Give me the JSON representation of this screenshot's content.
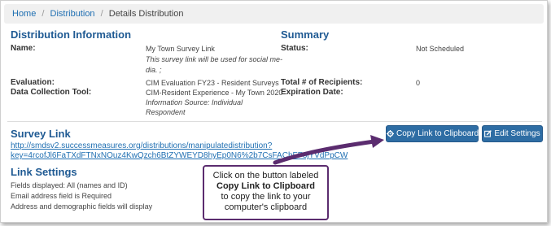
{
  "breadcrumb": {
    "home": "Home",
    "distribution": "Distribution",
    "current": "Details Distribution",
    "separator": "/"
  },
  "distribution_info": {
    "heading": "Distribution Information",
    "name_label": "Name:",
    "name_value": "My Town Survey Link",
    "name_desc_line1": "This survey link will be used for social me-",
    "name_desc_line2": "dia. ;",
    "evaluation_label": "Evaluation:",
    "evaluation_value": "CIM Evaluation FY23 - Resident Surveys",
    "tool_label": "Data Collection Tool:",
    "tool_value": "CIM-Resident Experience - My Town 2020",
    "info_source_line1": "Information Source: Individual",
    "info_source_line2": "Respondent"
  },
  "summary": {
    "heading": "Summary",
    "status_label": "Status:",
    "status_value": "Not Scheduled",
    "recipients_label": "Total # of Recipients:",
    "recipients_value": "0",
    "expiration_label": "Expiration Date:"
  },
  "survey_link": {
    "heading": "Survey Link",
    "url_line1": "http://smdsv2.successmeasures.org/distributions/manipulatedistribution?",
    "url_line2": "key=4rcofJl6FaTXdFTNxNOuz4KwQzch6BtZYWEYD8hyEp0N6%2b7CsFAChFF8jYVdPpCW",
    "copy_button": "Copy Link to Clipboard",
    "edit_button": "Edit Settings"
  },
  "link_settings": {
    "heading": "Link Settings",
    "line1": "Fields displayed: All (names and ID)",
    "line2": "Email address field is Required",
    "line3": "Address and demographic fields will display"
  },
  "callout": {
    "line1": "Click on the button labeled",
    "line2": "Copy Link to Clipboard",
    "line3": "to copy the link to your",
    "line4": "computer's clipboard"
  },
  "colors": {
    "heading": "#1f5a93",
    "link": "#1f6fb2",
    "button": "#2e6da4",
    "callout_border": "#5b2c6f"
  },
  "icons": {
    "copy_button_icon": "gear-icon",
    "edit_button_icon": "edit-icon"
  }
}
